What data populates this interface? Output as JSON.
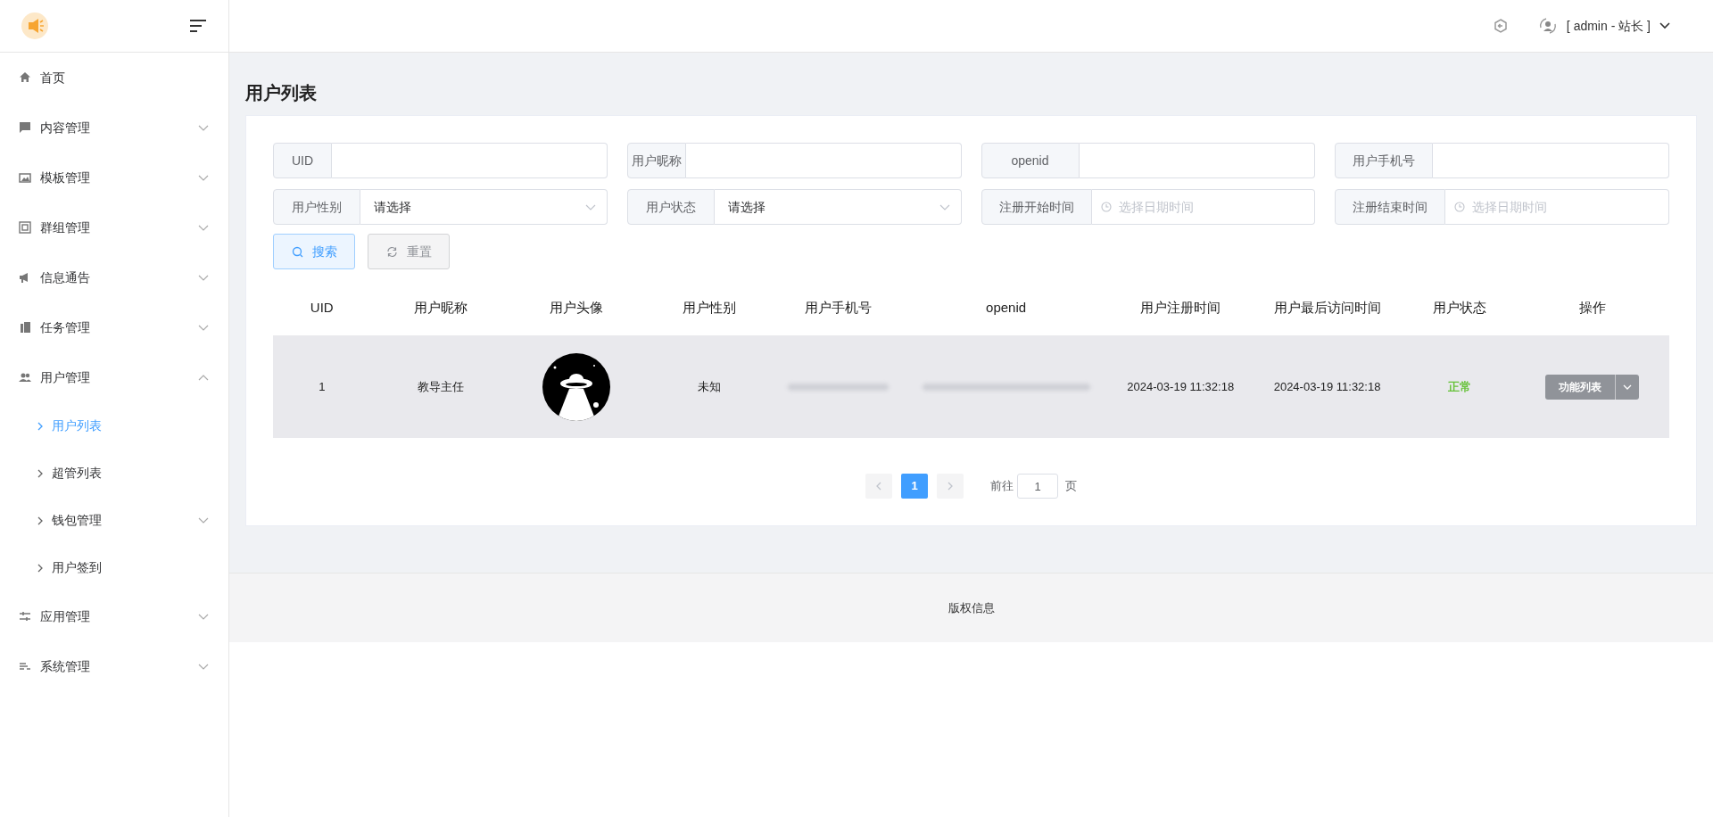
{
  "header": {
    "user": "[ admin - 站长 ]"
  },
  "sidebar": {
    "items": [
      {
        "label": "首页",
        "kind": "link"
      },
      {
        "label": "内容管理",
        "kind": "group",
        "expanded": false
      },
      {
        "label": "模板管理",
        "kind": "group",
        "expanded": false
      },
      {
        "label": "群组管理",
        "kind": "group",
        "expanded": false
      },
      {
        "label": "信息通告",
        "kind": "group",
        "expanded": false
      },
      {
        "label": "任务管理",
        "kind": "group",
        "expanded": false
      },
      {
        "label": "用户管理",
        "kind": "group",
        "expanded": true,
        "children": [
          {
            "label": "用户列表",
            "kind": "link",
            "selected": true
          },
          {
            "label": "超管列表",
            "kind": "link",
            "selected": false
          },
          {
            "label": "钱包管理",
            "kind": "group",
            "expanded": false,
            "selected": false
          },
          {
            "label": "用户签到",
            "kind": "link",
            "selected": false
          }
        ]
      },
      {
        "label": "应用管理",
        "kind": "group",
        "expanded": false
      },
      {
        "label": "系统管理",
        "kind": "group",
        "expanded": false
      }
    ]
  },
  "page_title": "用户列表",
  "filters": [
    {
      "label": "UID",
      "kind": "text"
    },
    {
      "label": "用户昵称",
      "kind": "text"
    },
    {
      "label": "openid",
      "kind": "text"
    },
    {
      "label": "用户手机号",
      "kind": "text"
    },
    {
      "label": "用户性别",
      "kind": "select",
      "value": "请选择"
    },
    {
      "label": "用户状态",
      "kind": "select",
      "value": "请选择"
    },
    {
      "label": "注册开始时间",
      "kind": "datetime",
      "placeholder": "选择日期时间"
    },
    {
      "label": "注册结束时间",
      "kind": "datetime",
      "placeholder": "选择日期时间"
    }
  ],
  "buttons": [
    {
      "label": "搜索",
      "kind": "primary"
    },
    {
      "label": "重置",
      "kind": "plain"
    }
  ],
  "table": {
    "columns": [
      "UID",
      "用户昵称",
      "用户头像",
      "用户性别",
      "用户手机号",
      "openid",
      "用户注册时间",
      "用户最后访问时间",
      "用户状态",
      "操作"
    ],
    "rows": [
      {
        "cells": [
          {
            "kind": "text",
            "text": "1"
          },
          {
            "kind": "text",
            "text": "教导主任"
          },
          {
            "kind": "picture"
          },
          {
            "kind": "text",
            "text": "未知"
          },
          {
            "kind": "blurred"
          },
          {
            "kind": "blurred"
          },
          {
            "kind": "text",
            "text": "2024-03-19 11:32:18"
          },
          {
            "kind": "text",
            "text": "2024-03-19 11:32:18"
          },
          {
            "kind": "status",
            "text": "正常"
          },
          {
            "kind": "action",
            "text": "功能列表"
          }
        ]
      }
    ]
  },
  "pagination": {
    "pages": [
      {
        "label": "1",
        "selected": true
      }
    ],
    "goto_label": "前往",
    "goto_value": "1",
    "page_unit": "页"
  },
  "footer": "版权信息"
}
